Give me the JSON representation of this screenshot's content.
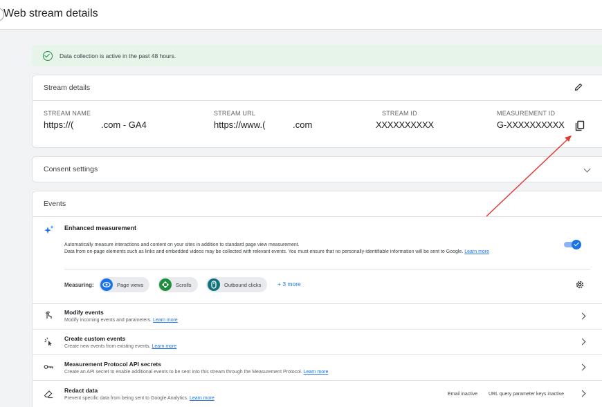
{
  "header": {
    "title": "Web stream details"
  },
  "banner": {
    "text": "Data collection is active in the past 48 hours."
  },
  "stream_details": {
    "title": "Stream details",
    "columns": [
      {
        "label": "STREAM NAME",
        "value": "https://(           .com - GA4"
      },
      {
        "label": "STREAM URL",
        "value": "https://www.(           .com"
      },
      {
        "label": "STREAM ID",
        "value": "XXXXXXXXXX"
      },
      {
        "label": "MEASUREMENT ID",
        "value": "G-XXXXXXXXXX"
      }
    ]
  },
  "consent": {
    "title": "Consent settings"
  },
  "events": {
    "title": "Events",
    "enhanced": {
      "title": "Enhanced measurement",
      "desc1": "Automatically measure interactions and content on your sites in addition to standard page view measurement.",
      "desc2": "Data from on-page elements such as links and embedded videos may be collected with relevant events. You must ensure that no personally-identifiable information will be sent to Google.",
      "learn_more": "Learn more",
      "enabled": true
    },
    "measuring_label": "Measuring:",
    "chips": [
      {
        "label": "Page views",
        "color": "#1a73e8",
        "icon": "eye-icon"
      },
      {
        "label": "Scrolls",
        "color": "#1e8e3e",
        "icon": "scroll-icon"
      },
      {
        "label": "Outbound clicks",
        "color": "#12737c",
        "icon": "mouse-icon"
      }
    ],
    "more_label": "+ 3 more",
    "rows": [
      {
        "title": "Modify events",
        "sub": "Modify incoming events and parameters.",
        "link": "Learn more"
      },
      {
        "title": "Create custom events",
        "sub": "Create new events from existing events.",
        "link": "Learn more"
      },
      {
        "title": "Measurement Protocol API secrets",
        "sub": "Create an API secret to enable additional events to be sent into this stream through the Measurement Protocol.",
        "link": "Learn more"
      },
      {
        "title": "Redact data",
        "sub": "Prevent specific data from being sent to Google Analytics.",
        "link": "Learn more"
      }
    ],
    "redact_status": {
      "email": "Email inactive",
      "url": "URL query parameter keys inactive"
    }
  },
  "colors": {
    "accent": "#1a73e8",
    "success": "#1e8e3e",
    "annotation_arrow": "#e53935"
  }
}
